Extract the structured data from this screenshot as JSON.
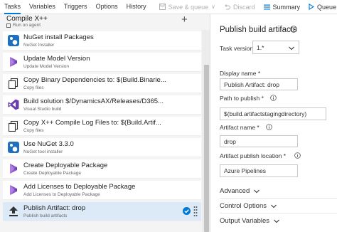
{
  "toolbar": {
    "tabs": [
      "Tasks",
      "Variables",
      "Triggers",
      "Options",
      "History"
    ],
    "save_label": "Save & queue",
    "save_chevron": "∨",
    "discard_label": "Discard",
    "summary_label": "Summary",
    "queue_label": "Queue",
    "accent": "#0078d4"
  },
  "phase": {
    "title": "Compile X++",
    "subtitle": "Run on agent",
    "add": "+"
  },
  "tasks": [
    {
      "name": "NuGet install Packages",
      "sub": "NuGet Installer",
      "icon": "nuget-icon"
    },
    {
      "name": "Update Model Version",
      "sub": "Update Model Version",
      "icon": "dynamics-icon"
    },
    {
      "name": "Copy Binary Dependencies to: $(Build.Binarie...",
      "sub": "Copy files",
      "icon": "copy-files-icon"
    },
    {
      "name": "Build solution $/DynamicsAX/Releases/D365...",
      "sub": "Visual Studio build",
      "icon": "visual-studio-icon"
    },
    {
      "name": "Copy X++ Compile Log Files to: $(Build.Artif...",
      "sub": "Copy files",
      "icon": "copy-files-icon"
    },
    {
      "name": "Use NuGet 3.3.0",
      "sub": "NuGet tool installer",
      "icon": "nuget-icon"
    },
    {
      "name": "Create Deployable Package",
      "sub": "Create Deployable Package",
      "icon": "dynamics-icon"
    },
    {
      "name": "Add Licenses to Deployable Package",
      "sub": "Add Licenses to Deployable Package",
      "icon": "dynamics-icon"
    },
    {
      "name": "Publish Artifact: drop",
      "sub": "Publish build artifacts",
      "icon": "upload-icon",
      "selected": true
    }
  ],
  "details": {
    "title": "Publish build artifacts",
    "task_version_label": "Task version",
    "task_version": "1.*",
    "display_name_label": "Display name *",
    "display_name": "Publish Artifact: drop",
    "path_label": "Path to publish *",
    "path_value": "$(build.artifactstagingdirectory)",
    "artifact_name_label": "Artifact name *",
    "artifact_name": "drop",
    "location_label": "Artifact publish location *",
    "location_value": "Azure Pipelines",
    "sections": [
      "Advanced",
      "Control Options",
      "Output Variables"
    ]
  }
}
